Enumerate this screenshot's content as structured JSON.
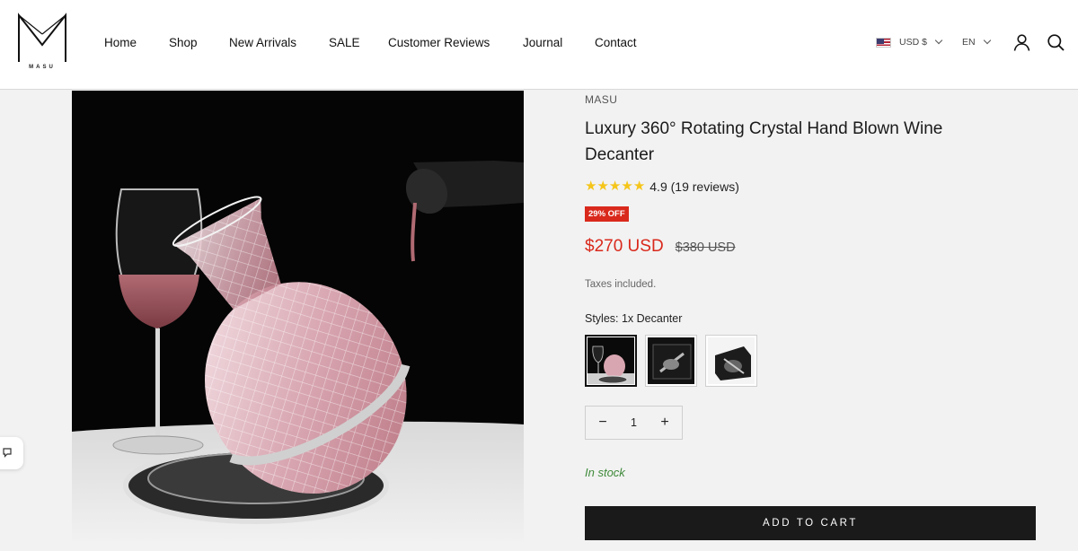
{
  "header": {
    "logo_text": "MASU",
    "nav": [
      {
        "label": "Home"
      },
      {
        "label": "Shop"
      },
      {
        "label": "New Arrivals"
      },
      {
        "label": "SALE"
      },
      {
        "label": "Customer Reviews"
      },
      {
        "label": "Journal"
      },
      {
        "label": "Contact"
      }
    ],
    "currency": "USD $",
    "language": "EN",
    "icons": [
      "account-icon",
      "search-icon",
      "chevron-down-icon",
      "us-flag-icon"
    ]
  },
  "product": {
    "vendor": "MASU",
    "title": "Luxury 360° Rotating Crystal Hand Blown Wine Decanter",
    "rating": {
      "stars": 5,
      "text": "4.9 (19 reviews)",
      "value": 4.9
    },
    "discount_badge": "29% OFF",
    "price_sale": "$270 USD",
    "price_compare": "$380 USD",
    "taxes_note": "Taxes included.",
    "styles_label": "Styles: 1x Decanter",
    "swatches": [
      {
        "name": "1x Decanter",
        "selected": true
      },
      {
        "name": "style-2",
        "selected": false
      },
      {
        "name": "style-3",
        "selected": false
      }
    ],
    "quantity": "1",
    "stock_status": "In stock",
    "add_to_cart_label": "ADD TO CART"
  },
  "colors": {
    "sale_red": "#d9291c",
    "stock_green": "#3f8a3a",
    "button_black": "#1a1a1a",
    "star_gold": "#f5c518"
  }
}
